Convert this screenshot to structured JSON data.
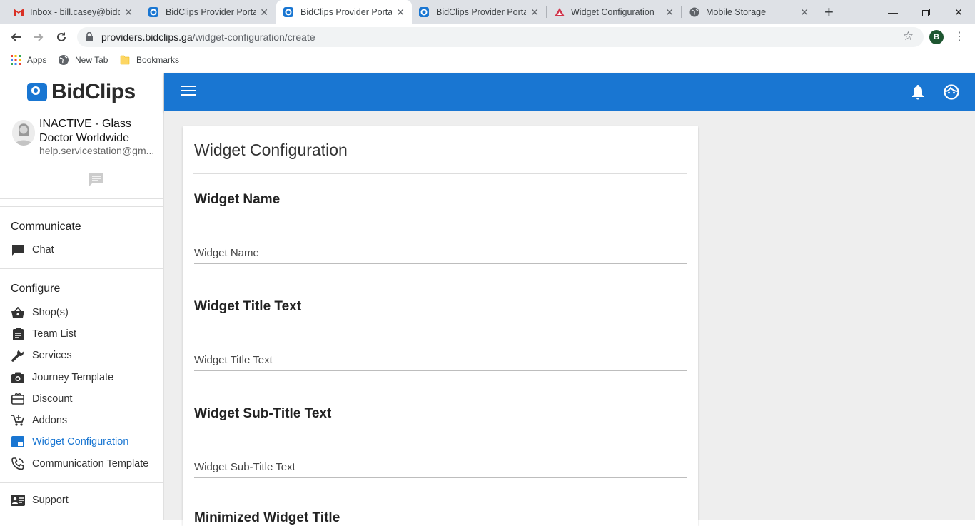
{
  "browser": {
    "tabs": [
      {
        "title": "Inbox - bill.casey@bidc",
        "icon": "gmail-icon",
        "active": false
      },
      {
        "title": "BidClips Provider Portal",
        "icon": "bidclips-icon",
        "active": false
      },
      {
        "title": "BidClips Provider Portal",
        "icon": "bidclips-icon",
        "active": true
      },
      {
        "title": "BidClips Provider Portal",
        "icon": "bidclips-icon",
        "active": false
      },
      {
        "title": "Widget Configuration",
        "icon": "triangle-icon",
        "active": false
      },
      {
        "title": "Mobile Storage",
        "icon": "globe-icon",
        "active": false
      }
    ],
    "url_host": "providers.bidclips.ga",
    "url_path": "/widget-configuration/create",
    "profile_initial": "B",
    "bookmarks": [
      {
        "label": "Apps",
        "icon": "apps-grid-icon"
      },
      {
        "label": "New Tab",
        "icon": "globe-icon"
      },
      {
        "label": "Bookmarks",
        "icon": "folder-icon"
      }
    ]
  },
  "app": {
    "brand": "BidClips",
    "brand_color": "#1976d2",
    "profile": {
      "name": "INACTIVE - Glass Doctor Worldwide",
      "email": "help.servicestation@gm..."
    },
    "sections": {
      "communicate": "Communicate",
      "configure": "Configure"
    },
    "nav": {
      "chat": "Chat",
      "shops": "Shop(s)",
      "team_list": "Team List",
      "services": "Services",
      "journey_template": "Journey Template",
      "discount": "Discount",
      "addons": "Addons",
      "widget_configuration": "Widget Configuration",
      "communication_template": "Communication Template",
      "support": "Support"
    },
    "active_nav": "widget_configuration"
  },
  "form": {
    "title": "Widget Configuration",
    "sections": [
      {
        "heading": "Widget Name",
        "placeholder": "Widget Name"
      },
      {
        "heading": "Widget Title Text",
        "placeholder": "Widget Title Text"
      },
      {
        "heading": "Widget Sub-Title Text",
        "placeholder": "Widget Sub-Title Text"
      },
      {
        "heading": "Minimized Widget Title",
        "placeholder": ""
      }
    ]
  }
}
